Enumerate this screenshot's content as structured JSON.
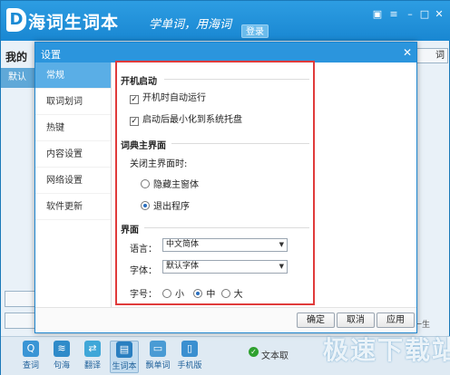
{
  "app": {
    "logo_letter": "D",
    "logo_text": "海词生词本",
    "slogan": "学单词，用海词",
    "login_label": "登录",
    "wordbook_label": "我的",
    "default_tab_label": "默认",
    "right_button_label": "词",
    "right_bottom_stub": "一生",
    "window_controls": [
      "skin-icon",
      "menu-icon",
      "minimize-icon",
      "maximize-icon",
      "close-icon"
    ]
  },
  "toolbar": {
    "items": [
      {
        "label": "查词",
        "icon": "search-book-icon"
      },
      {
        "label": "句海",
        "icon": "sentence-icon"
      },
      {
        "label": "翻译",
        "icon": "translate-icon"
      },
      {
        "label": "生词本",
        "icon": "wordbook-icon"
      },
      {
        "label": "飘单词",
        "icon": "floating-word-icon"
      },
      {
        "label": "手机版",
        "icon": "mobile-icon"
      }
    ],
    "active_index": 3,
    "status_text": "文本取"
  },
  "watermark": "极速下载站",
  "dialog": {
    "title": "设置",
    "nav": [
      "常规",
      "取词划词",
      "热键",
      "内容设置",
      "网络设置",
      "软件更新"
    ],
    "nav_active": 0,
    "startup": {
      "heading": "开机启动",
      "auto_run_label": "开机时自动运行",
      "auto_run_checked": true,
      "minimize_tray_label": "启动后最小化到系统托盘",
      "minimize_tray_checked": true
    },
    "main_window": {
      "heading": "词典主界面",
      "close_label": "关闭主界面时:",
      "option_hide": "隐藏主窗体",
      "option_exit": "退出程序",
      "selected": "exit"
    },
    "interface": {
      "heading": "界面",
      "language_label": "语言：",
      "language_value": "中文简体",
      "font_label": "字体：",
      "font_value": "默认字体",
      "size_label": "字号：",
      "size_options": [
        "小",
        "中",
        "大"
      ],
      "size_selected": "中"
    },
    "buttons": {
      "ok": "确定",
      "cancel": "取消",
      "apply": "应用"
    }
  },
  "colors": {
    "header_blue": "#1987d2",
    "highlight_border": "#e03b3b",
    "nav_active": "#5aaee6"
  }
}
